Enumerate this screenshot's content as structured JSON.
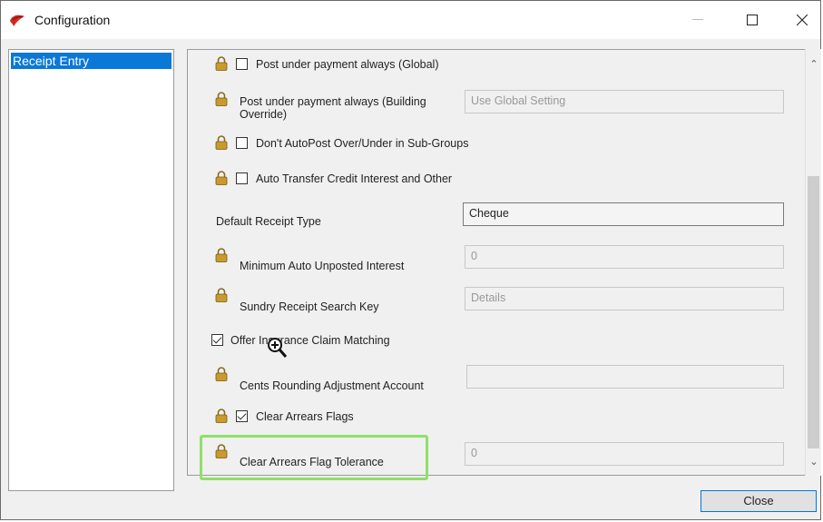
{
  "window": {
    "title": "Configuration",
    "minimize_icon": "minimize-icon",
    "maximize_icon": "maximize-icon",
    "close_icon": "close-icon"
  },
  "sidebar": {
    "items": [
      {
        "label": "Receipt Entry",
        "selected": true
      }
    ]
  },
  "settings": {
    "post_under_payment_global": {
      "label": "Post under payment always (Global)",
      "checked": false
    },
    "post_under_payment_building": {
      "label_line1": "Post under payment always (Building",
      "label_line2": "Override)",
      "value": "Use Global Setting"
    },
    "dont_autopost": {
      "label": "Don't AutoPost Over/Under in Sub-Groups",
      "checked": false
    },
    "auto_transfer": {
      "label": "Auto Transfer Credit Interest and Other",
      "checked": false
    },
    "default_receipt_type": {
      "label": "Default Receipt Type",
      "value": "Cheque"
    },
    "min_auto_unposted": {
      "label": "Minimum Auto Unposted Interest",
      "value": "0"
    },
    "sundry_search_key": {
      "label": "Sundry Receipt Search Key",
      "value": "Details"
    },
    "offer_insurance": {
      "label": "Offer Insurance Claim Matching",
      "checked": true
    },
    "cents_rounding": {
      "label": "Cents Rounding Adjustment Account",
      "value": ""
    },
    "clear_arrears_flags": {
      "label": "Clear Arrears Flags",
      "checked": true
    },
    "clear_arrears_tolerance": {
      "label": "Clear Arrears Flag Tolerance",
      "value": "0"
    }
  },
  "footer": {
    "close_label": "Close"
  },
  "colors": {
    "selection": "#0a78d7",
    "highlight_box": "#8ee06a",
    "lock_gold": "#c99a2e"
  }
}
